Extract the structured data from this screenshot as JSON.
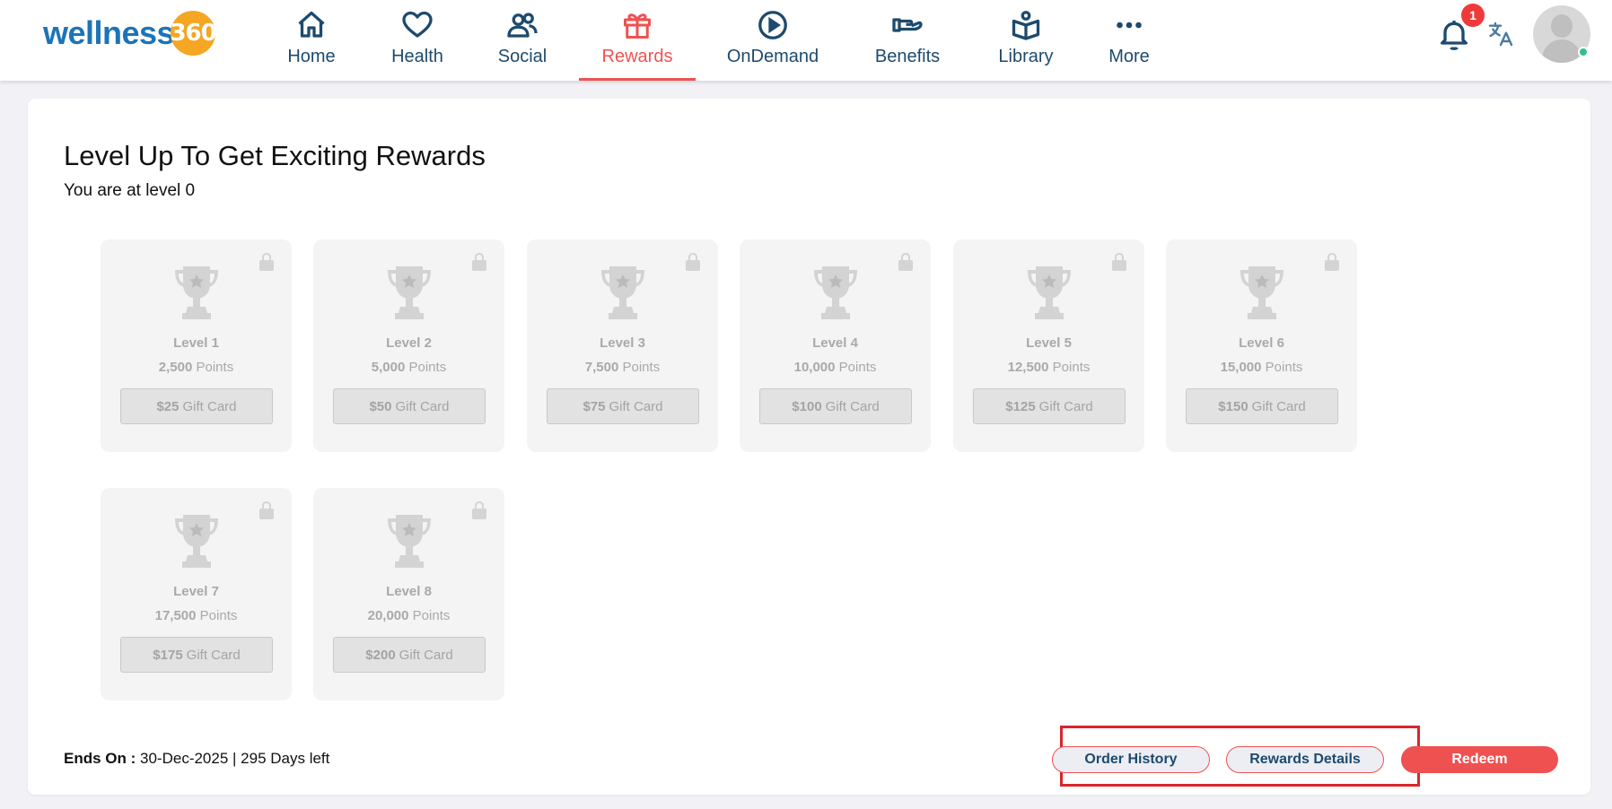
{
  "brand": {
    "name": "wellness",
    "badge": "360"
  },
  "nav": [
    {
      "label": "Home",
      "icon": "home-icon"
    },
    {
      "label": "Health",
      "icon": "heart-icon"
    },
    {
      "label": "Social",
      "icon": "users-icon"
    },
    {
      "label": "Rewards",
      "icon": "gift-icon",
      "active": true
    },
    {
      "label": "OnDemand",
      "icon": "play-icon"
    },
    {
      "label": "Benefits",
      "icon": "hand-icon"
    },
    {
      "label": "Library",
      "icon": "book-icon"
    },
    {
      "label": "More",
      "icon": "more-dots-icon"
    }
  ],
  "header_actions": {
    "notification_count": "1"
  },
  "page": {
    "title": "Level Up To Get Exciting Rewards",
    "level_text": "You are at level 0"
  },
  "levels": [
    {
      "name": "Level 1",
      "points": "2,500",
      "points_label": "Points",
      "amount": "$25",
      "card_label": "Gift Card"
    },
    {
      "name": "Level 2",
      "points": "5,000",
      "points_label": "Points",
      "amount": "$50",
      "card_label": "Gift Card"
    },
    {
      "name": "Level 3",
      "points": "7,500",
      "points_label": "Points",
      "amount": "$75",
      "card_label": "Gift Card"
    },
    {
      "name": "Level 4",
      "points": "10,000",
      "points_label": "Points",
      "amount": "$100",
      "card_label": "Gift Card"
    },
    {
      "name": "Level 5",
      "points": "12,500",
      "points_label": "Points",
      "amount": "$125",
      "card_label": "Gift Card"
    },
    {
      "name": "Level 6",
      "points": "15,000",
      "points_label": "Points",
      "amount": "$150",
      "card_label": "Gift Card"
    },
    {
      "name": "Level 7",
      "points": "17,500",
      "points_label": "Points",
      "amount": "$175",
      "card_label": "Gift Card"
    },
    {
      "name": "Level 8",
      "points": "20,000",
      "points_label": "Points",
      "amount": "$200",
      "card_label": "Gift Card"
    }
  ],
  "footer": {
    "ends_label": "Ends On :",
    "ends_value": "30-Dec-2025 | 295 Days left",
    "order_history": "Order History",
    "rewards_details": "Rewards Details",
    "redeem": "Redeem"
  },
  "colors": {
    "accent": "#ef5151",
    "nav_text": "#1d4a6e",
    "brand_blue": "#1c74b8",
    "brand_orange": "#f5a623",
    "highlight": "#d9262c"
  }
}
